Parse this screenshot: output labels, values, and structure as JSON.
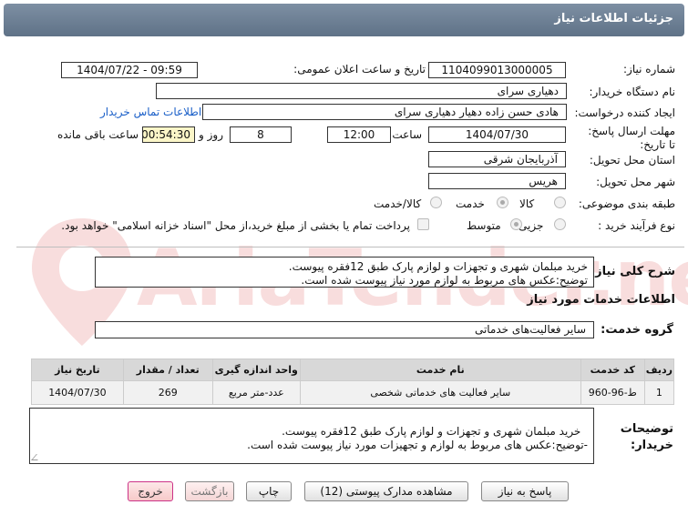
{
  "title": "جزئیات اطلاعات نیاز",
  "fields": {
    "need_number_label": "شماره نیاز:",
    "need_number": "1104099013000005",
    "announce_label": "تاریخ و ساعت اعلان عمومی:",
    "announce_value": "1404/07/22 - 09:59",
    "buyer_org_label": "نام دستگاه خریدار:",
    "buyer_org": "دهیاری سرای",
    "creator_label": "ایجاد کننده درخواست:",
    "creator": "هادی حسن زاده دهیار دهیاری سرای",
    "contact_link": "اطلاعات تماس خریدار",
    "deadline_label": "مهلت ارسال پاسخ: تا تاریخ:",
    "deadline_date": "1404/07/30",
    "time_label": "ساعت",
    "deadline_time": "12:00",
    "days_value": "8",
    "days_label": "روز و",
    "remaining_time": "00:54:30",
    "remaining_label": "ساعت باقی مانده",
    "province_label": "استان محل تحویل:",
    "province": "آذربایجان شرقی",
    "city_label": "شهر محل تحویل:",
    "city": "هریس",
    "category_label": "طبقه بندی موضوعی:",
    "category_options": [
      "کالا",
      "خدمت",
      "کالا/خدمت"
    ],
    "process_label": "نوع فرآیند خرید :",
    "process_options": [
      "جزیی",
      "متوسط"
    ],
    "payment_note": "پرداخت تمام یا بخشی از مبلغ خرید،از محل \"اسناد خزانه اسلامی\" خواهد بود."
  },
  "general_desc": {
    "label": "شرح کلی نیاز:",
    "text": "خرید مبلمان شهری و تجهزات و لوازم پارک طبق 12فقره پیوست.\nتوضیح:عکس های مربوط به لوازم مورد نیاز پیوست شده است."
  },
  "services": {
    "section_title": "اطلاعات خدمات مورد نیاز",
    "group_label": "گروه خدمت:",
    "group_value": "سایر فعالیت‌های خدماتی",
    "columns": [
      "ردیف",
      "کد خدمت",
      "نام خدمت",
      "واحد اندازه گیری",
      "تعداد / مقدار",
      "تاریخ نیاز"
    ],
    "rows": [
      [
        "1",
        "ط-96-960",
        "سایر فعالیت های خدماتی شخصی",
        "عدد-متر مربع",
        "269",
        "1404/07/30"
      ]
    ]
  },
  "buyer_notes": {
    "label": "توضیحات خریدار:",
    "text": "خرید مبلمان شهری و تجهزات و لوازم پارک طبق 12فقره پیوست.\n-توضیح:عکس های مربوط به لوازم و تجهیزات مورد نیاز پیوست شده است."
  },
  "buttons": {
    "reply": "پاسخ به نیاز",
    "attachments": "مشاهده مدارک پیوستی (12)",
    "print": "چاپ",
    "back": "بازگشت",
    "exit": "خروج"
  },
  "watermark": "AriaTender.net",
  "colors": {
    "titlebar": "#6d8096",
    "link": "#1a5fc8",
    "remaining_bg": "#fbf6c8"
  }
}
